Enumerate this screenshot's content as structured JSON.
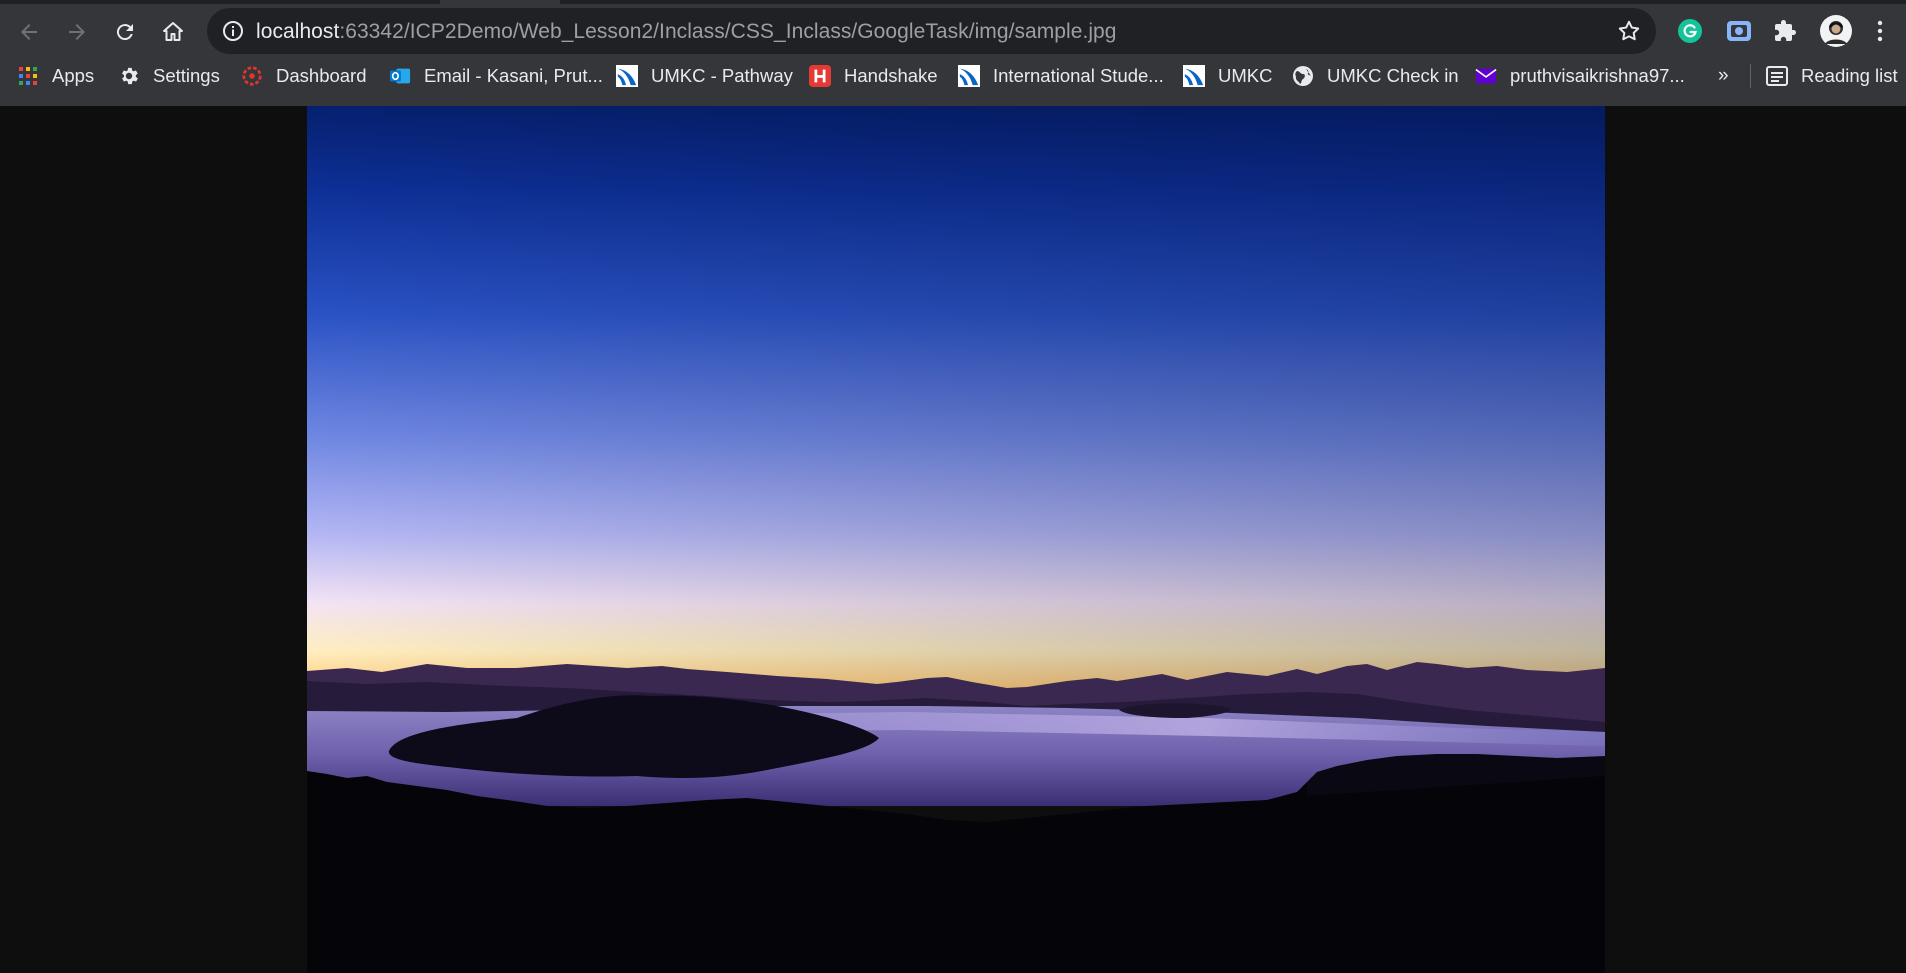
{
  "browser": {
    "url_host": "localhost",
    "url_rest": ":63342/ICP2Demo/Web_Lesson2/Inclass/CSS_Inclass/GoogleTask/img/sample.jpg",
    "nav": [
      "back-icon",
      "forward-icon",
      "reload-icon",
      "home-icon"
    ],
    "extensions": [
      "grammarly-icon",
      "screen-capture-icon",
      "puzzle-icon",
      "profile-avatar",
      "more-menu-icon"
    ]
  },
  "bookmarks": {
    "items": [
      {
        "label": "Apps",
        "icon": "apps-grid-icon"
      },
      {
        "label": "Settings",
        "icon": "gear-icon"
      },
      {
        "label": "Dashboard",
        "icon": "canvas-logo-icon",
        "color": "#e3342f"
      },
      {
        "label": "Email - Kasani, Prut...",
        "icon": "outlook-icon",
        "color": "#0078d4"
      },
      {
        "label": "UMKC - Pathway",
        "icon": "umkc-logo-icon",
        "color": "#0a66c2"
      },
      {
        "label": "Handshake",
        "icon": "handshake-icon",
        "color": "#e53935"
      },
      {
        "label": "International Stude...",
        "icon": "umkc-logo-icon",
        "color": "#0a66c2"
      },
      {
        "label": "UMKC",
        "icon": "umkc-logo-icon",
        "color": "#0a66c2"
      },
      {
        "label": "UMKC Check in",
        "icon": "globe-icon"
      },
      {
        "label": "pruthvisaikrishna97...",
        "icon": "mail-icon",
        "color": "#6001d2"
      }
    ],
    "overflow": "»",
    "reading_list": "Reading list"
  },
  "image": {
    "subject": "sunset-over-lake-photo",
    "sky_top": "#041a6a",
    "horizon": "#ff9a4a",
    "background": "#0e0e0e"
  }
}
